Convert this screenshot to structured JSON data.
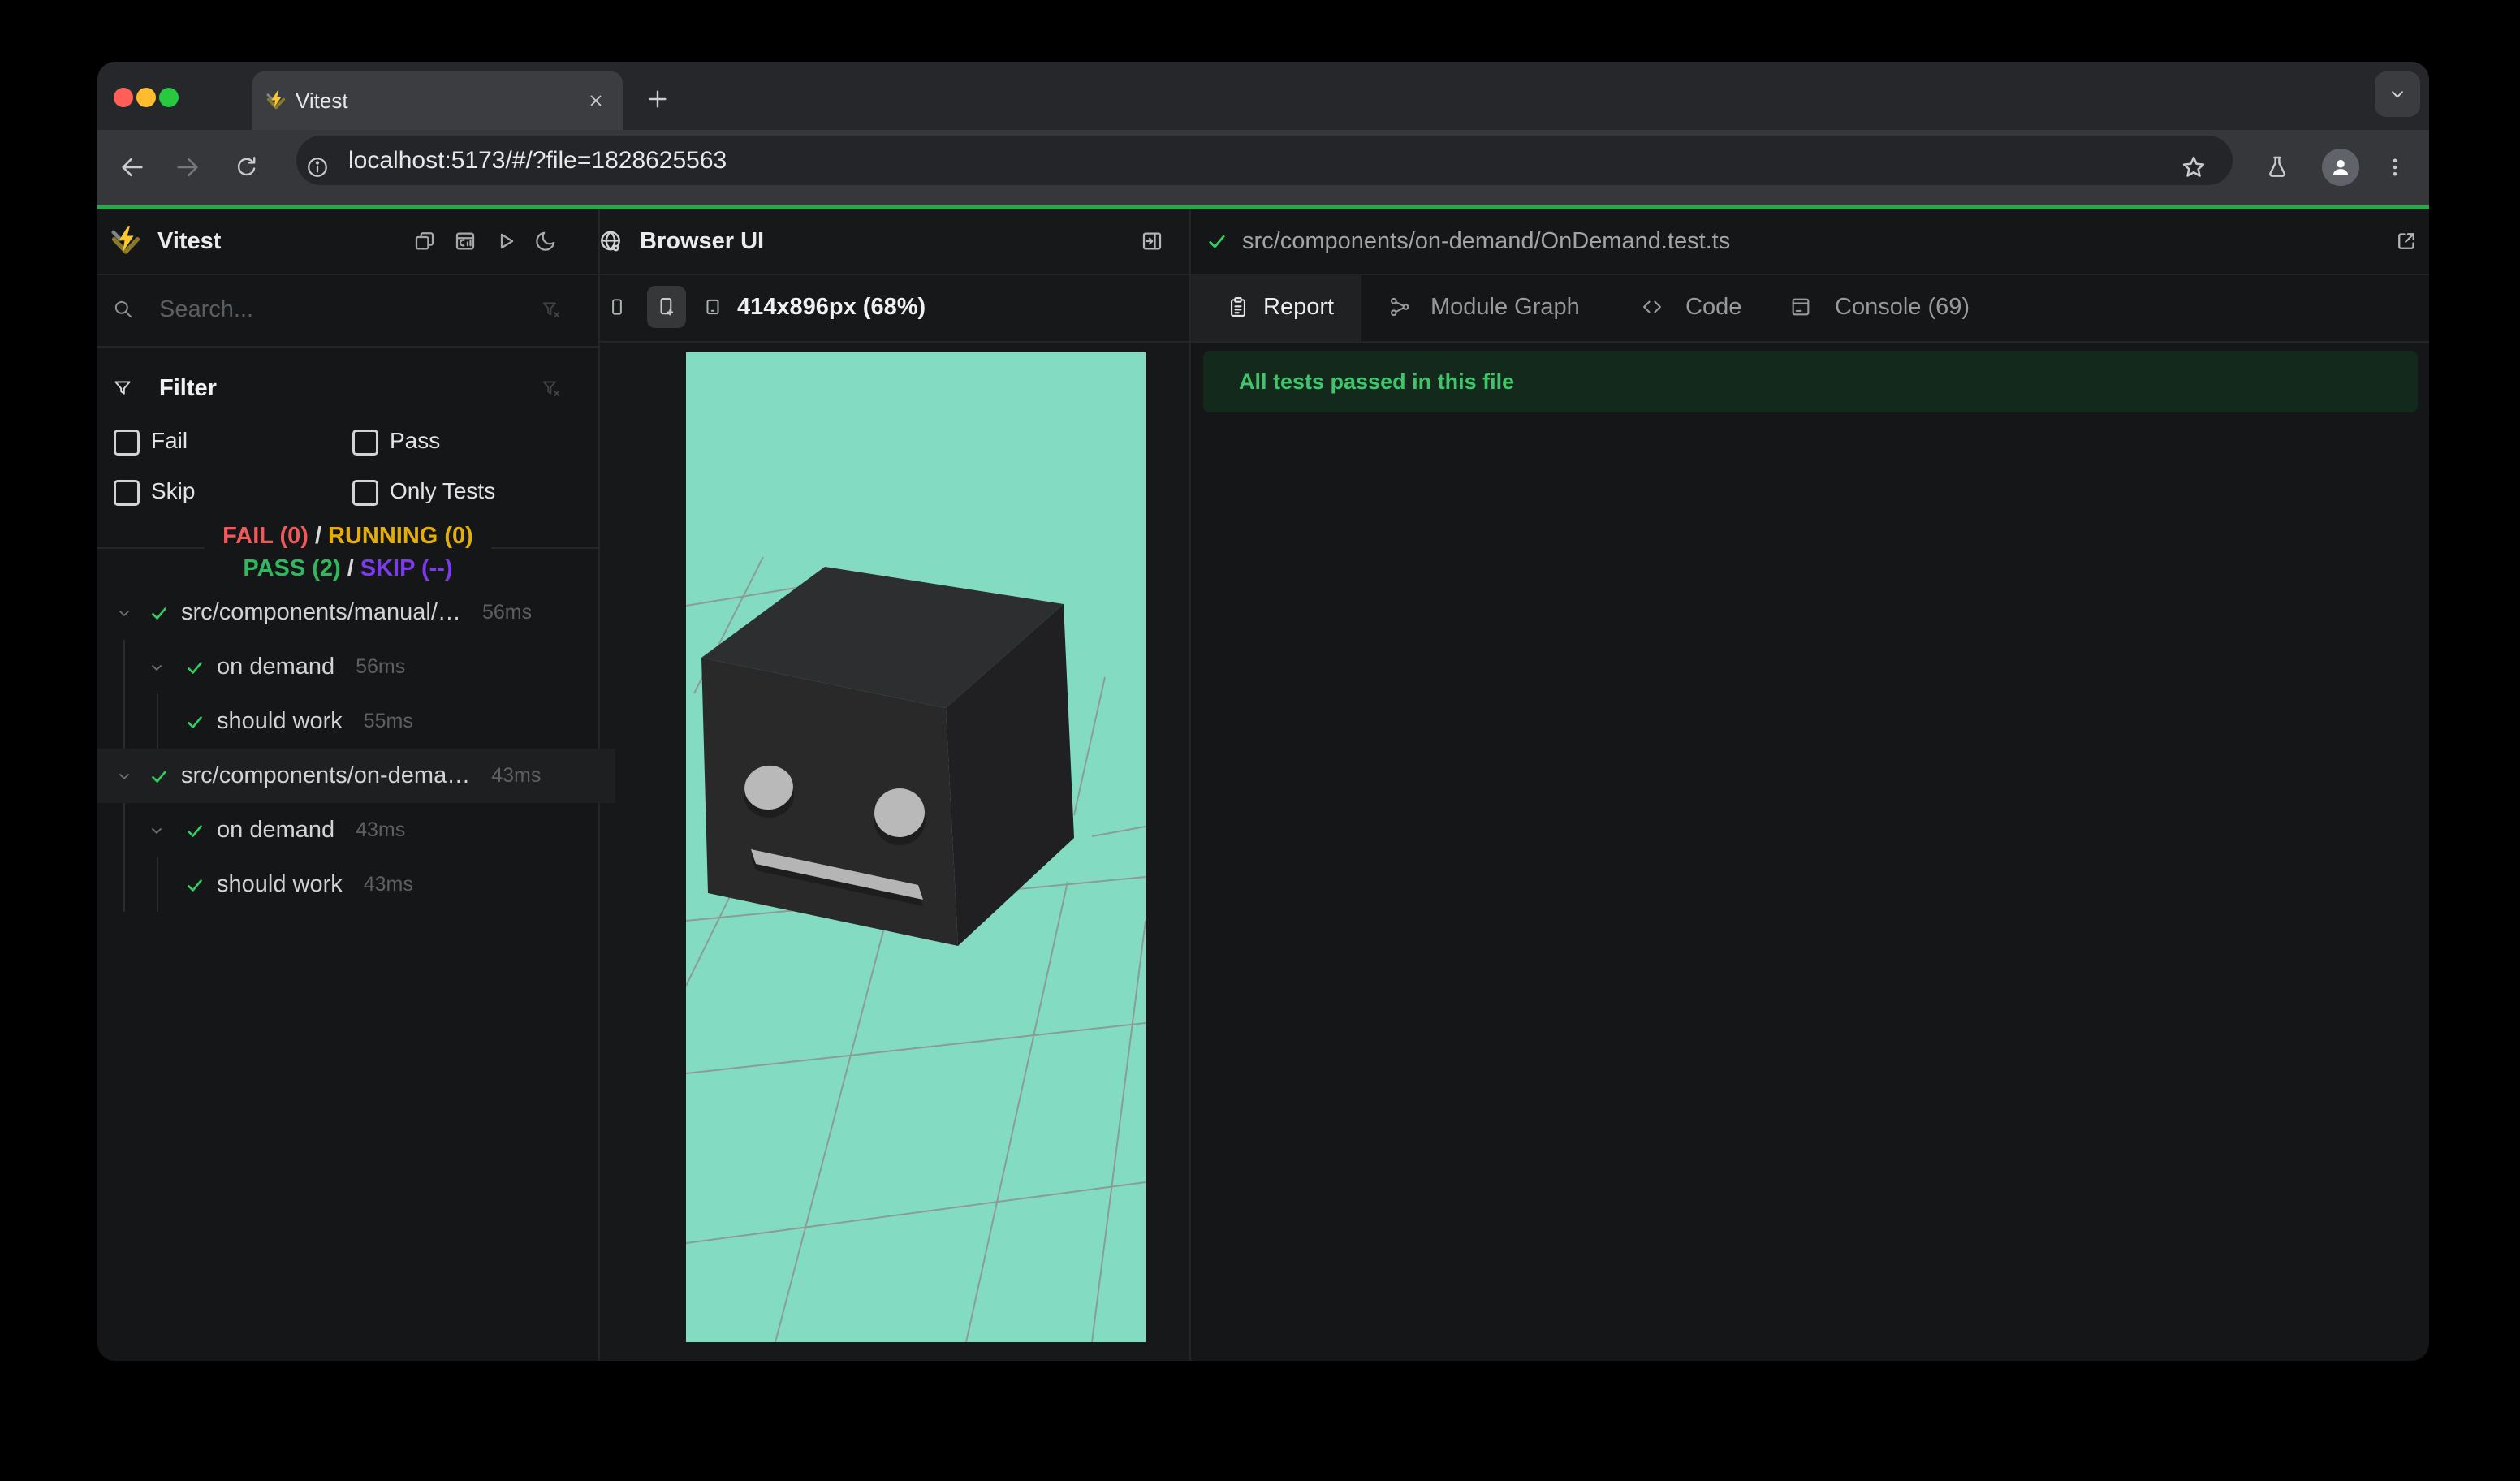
{
  "chrome": {
    "tab_title": "Vitest",
    "new_tab_label": "+",
    "close_tab_label": "×",
    "url": "localhost:5173/#/?file=1828625563",
    "colors": {
      "toolbar": "#35373a",
      "tab_strip": "#26272a",
      "progress_green": "#2da44e",
      "traffic_red": "#ff5f57",
      "traffic_yellow": "#febc2e",
      "traffic_green": "#28c841"
    }
  },
  "sidebar": {
    "title": "Vitest",
    "search_placeholder": "Search...",
    "filter": {
      "title": "Filter",
      "options": [
        "Fail",
        "Pass",
        "Skip",
        "Only Tests"
      ],
      "checked": [
        false,
        false,
        false,
        false
      ]
    },
    "summary": {
      "fail": "FAIL (0)",
      "running": "RUNNING (0)",
      "pass": "PASS (2)",
      "skip": "SKIP (--)",
      "separator": "/",
      "colors": {
        "fail": "#f0595c",
        "running": "#e5ae06",
        "pass": "#30b85c",
        "skip": "#7c3aed"
      }
    },
    "tree": [
      {
        "label": "src/components/manual/…",
        "duration": "56ms",
        "depth": 0,
        "type": "file",
        "status": "pass",
        "selected": false
      },
      {
        "label": "on demand",
        "duration": "56ms",
        "depth": 1,
        "type": "suite",
        "status": "pass",
        "selected": false
      },
      {
        "label": "should work",
        "duration": "55ms",
        "depth": 2,
        "type": "test",
        "status": "pass",
        "selected": false
      },
      {
        "label": "src/components/on-dema…",
        "duration": "43ms",
        "depth": 0,
        "type": "file",
        "status": "pass",
        "selected": true
      },
      {
        "label": "on demand",
        "duration": "43ms",
        "depth": 1,
        "type": "suite",
        "status": "pass",
        "selected": false
      },
      {
        "label": "should work",
        "duration": "43ms",
        "depth": 2,
        "type": "test",
        "status": "pass",
        "selected": false
      }
    ]
  },
  "browser_panel": {
    "title": "Browser UI",
    "viewport_label": "414x896px (68%)"
  },
  "report_panel": {
    "file_path": "src/components/on-demand/OnDemand.test.ts",
    "file_status": "pass",
    "tabs": [
      {
        "label": "Report",
        "active": true
      },
      {
        "label": "Module Graph",
        "active": false
      },
      {
        "label": "Code",
        "active": false
      },
      {
        "label": "Console (69)",
        "active": false
      }
    ],
    "banner": "All tests passed in this file"
  },
  "viewport": {
    "background": "#83dcc1",
    "grid_color": "#8d918e",
    "cube": {
      "top": "#2d2e2f",
      "front": "#29292a",
      "right": "#202022",
      "eye": "#b9b9b9",
      "mouth": "#b4b5b4",
      "shadow": "#1d1d1e"
    }
  },
  "icons": [
    "vitest-logo",
    "back-icon",
    "forward-icon",
    "reload-icon",
    "info-icon",
    "star-icon",
    "flask-icon",
    "profile-icon",
    "menu-dots-icon",
    "chevron-down-icon",
    "plus-icon",
    "close-icon",
    "search-icon",
    "funnel-icon",
    "funnel-clear-icon",
    "check-icon",
    "windows-stack-icon",
    "dashboard-icon",
    "play-icon",
    "moon-icon",
    "globe-icon",
    "dock-right-icon",
    "phone-icon",
    "phone-plus-icon",
    "tablet-icon",
    "clipboard-icon",
    "module-graph-icon",
    "code-icon",
    "console-icon",
    "external-link-icon"
  ]
}
